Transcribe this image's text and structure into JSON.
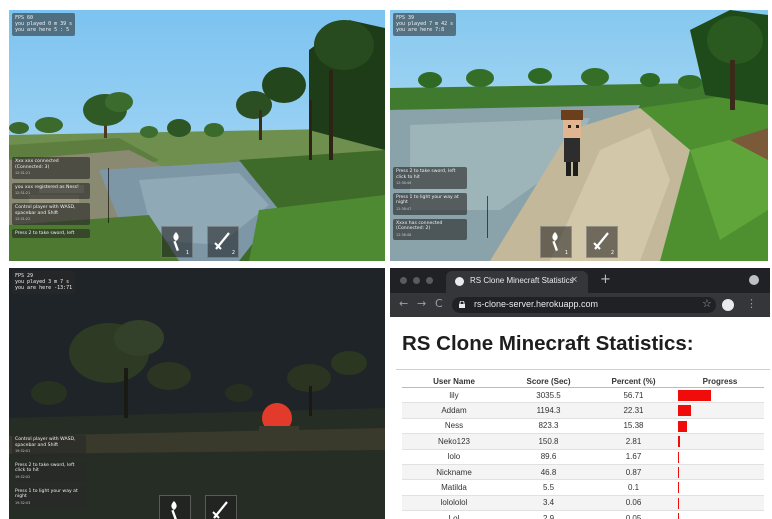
{
  "panels": {
    "top_left": {
      "hud": [
        "FPS 60",
        "you played 0 m 39 s",
        "you are here 5 : 5"
      ],
      "messages": [
        {
          "text": "Xxx xxx connected (Connected: 3)",
          "time": "12:31:21"
        },
        {
          "text": "you xxx registered as Ness!",
          "time": "12:31:21"
        },
        {
          "text": "Control player with WASD, spacebar and Shift",
          "time": "12:31:22"
        },
        {
          "text": "Press 2 to take sword, left",
          "time": ""
        }
      ],
      "slots": [
        "1",
        "2"
      ]
    },
    "top_right": {
      "hud": [
        "FPS 39",
        "you played 7 m 42 s",
        "you are here 7:8"
      ],
      "messages": [
        {
          "text": "Press 2 to take sword, left click to hit",
          "time": "12:38:46"
        },
        {
          "text": "Press 1 to light your way at night",
          "time": "12:38:47"
        },
        {
          "text": "Xxxx has connected (Connected: 2)",
          "time": "12:38:48"
        }
      ],
      "slots": [
        "1",
        "2"
      ]
    },
    "bottom_left": {
      "hud": [
        "FPS 29",
        "you played 3 m 7 s",
        "you are here -13:71"
      ],
      "messages": [
        {
          "text": "Control player with WASD, spacebar and Shift",
          "time": "19:32:01"
        },
        {
          "text": "Press 2 to take sword, left click to hit",
          "time": "19:32:02"
        },
        {
          "text": "Press 1 to light your way at night",
          "time": "19:32:03"
        }
      ],
      "slots": [
        "1",
        "2"
      ]
    }
  },
  "browser": {
    "tab_title": "RS Clone Minecraft Statistics",
    "tab_close": "×",
    "new_tab": "+",
    "url": "rs-clone-server.herokuapp.com",
    "nav": {
      "back": "←",
      "forward": "→",
      "reload": "C"
    },
    "star": "☆",
    "menu": "⋮",
    "page_title": "RS Clone Minecraft Statistics:",
    "columns": [
      "User Name",
      "Score (Sec)",
      "Percent (%)",
      "Progress"
    ],
    "rows": [
      {
        "name": "lily",
        "score": "3035.5",
        "percent": "56.71",
        "progress": 56.71
      },
      {
        "name": "Addam",
        "score": "1194.3",
        "percent": "22.31",
        "progress": 22.31
      },
      {
        "name": "Ness",
        "score": "823.3",
        "percent": "15.38",
        "progress": 15.38
      },
      {
        "name": "Neko123",
        "score": "150.8",
        "percent": "2.81",
        "progress": 2.81
      },
      {
        "name": "lolo",
        "score": "89.6",
        "percent": "1.67",
        "progress": 1.67
      },
      {
        "name": "Nickname",
        "score": "46.8",
        "percent": "0.87",
        "progress": 0.87
      },
      {
        "name": "Matilda",
        "score": "5.5",
        "percent": "0.1",
        "progress": 0.1
      },
      {
        "name": "lolololol",
        "score": "3.4",
        "percent": "0.06",
        "progress": 0.06
      },
      {
        "name": "Lol",
        "score": "2.9",
        "percent": "0.05",
        "progress": 0.05
      }
    ],
    "colors": {
      "progress_bar": "#f10c0c",
      "tab_strip": "#202124",
      "toolbar": "#35363a"
    }
  }
}
